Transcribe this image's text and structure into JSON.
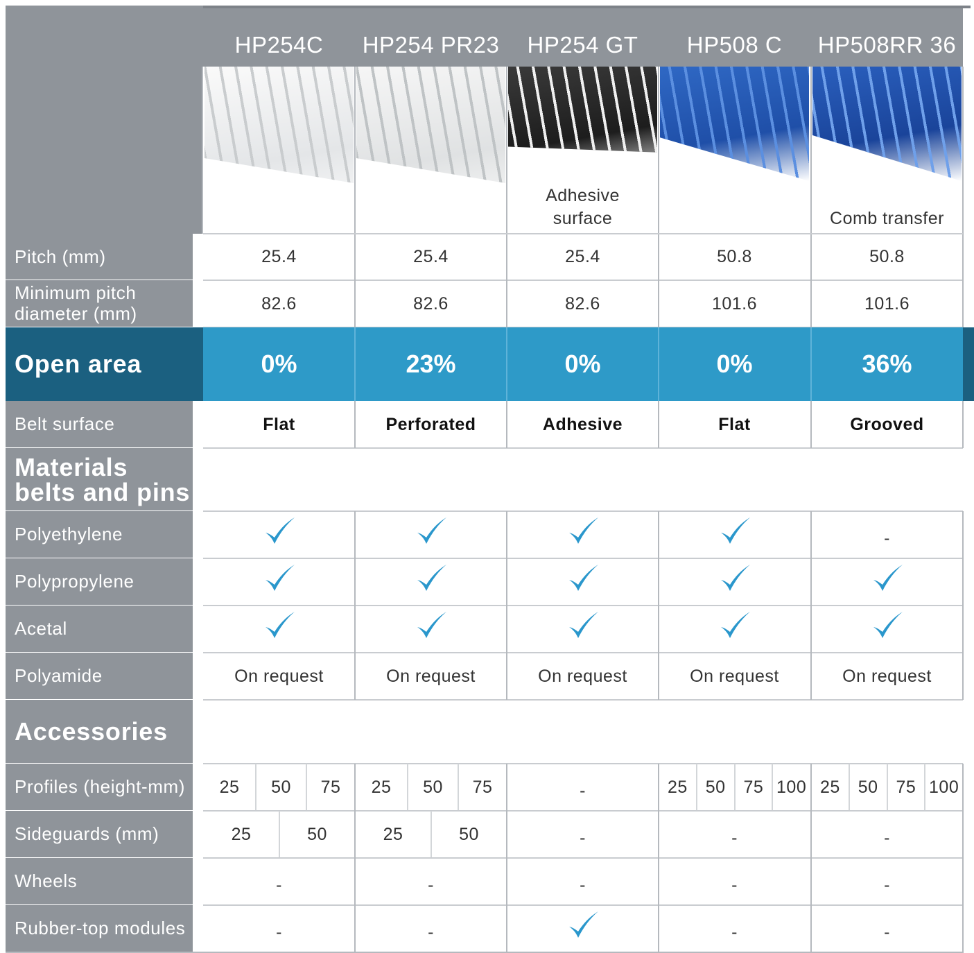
{
  "columns": [
    "HP254C",
    "HP254 PR23",
    "HP254 GT",
    "HP508 C",
    "HP508RR 36"
  ],
  "image_captions": [
    "",
    "",
    "Adhesive\nsurface",
    "",
    "Comb transfer"
  ],
  "rows": {
    "pitch": {
      "label": "Pitch (mm)",
      "values": [
        "25.4",
        "25.4",
        "25.4",
        "50.8",
        "50.8"
      ]
    },
    "min_pitch": {
      "label": "Minimum pitch\ndiameter (mm)",
      "values": [
        "82.6",
        "82.6",
        "82.6",
        "101.6",
        "101.6"
      ]
    },
    "open_area": {
      "label": "Open area",
      "values": [
        "0%",
        "23%",
        "0%",
        "0%",
        "36%"
      ]
    },
    "belt_surface": {
      "label": "Belt surface",
      "values": [
        "Flat",
        "Perforated",
        "Adhesive",
        "Flat",
        "Grooved"
      ]
    },
    "materials_heading": "Materials\nbelts and pins",
    "polyethylene": {
      "label": "Polyethylene",
      "values": [
        "check",
        "check",
        "check",
        "check",
        "-"
      ]
    },
    "polypropylene": {
      "label": "Polypropylene",
      "values": [
        "check",
        "check",
        "check",
        "check",
        "check"
      ]
    },
    "acetal": {
      "label": "Acetal",
      "values": [
        "check",
        "check",
        "check",
        "check",
        "check"
      ]
    },
    "polyamide": {
      "label": "Polyamide",
      "values": [
        "On request",
        "On request",
        "On request",
        "On request",
        "On request"
      ]
    },
    "accessories_heading": "Accessories",
    "profiles": {
      "label": "Profiles (height-mm)",
      "values": [
        [
          "25",
          "50",
          "75"
        ],
        [
          "25",
          "50",
          "75"
        ],
        [
          "-"
        ],
        [
          "25",
          "50",
          "75",
          "100"
        ],
        [
          "25",
          "50",
          "75",
          "100"
        ]
      ]
    },
    "sideguards": {
      "label": "Sideguards (mm)",
      "values": [
        [
          "25",
          "50"
        ],
        [
          "25",
          "50"
        ],
        [
          "-"
        ],
        [
          "-"
        ],
        [
          "-"
        ]
      ]
    },
    "wheels": {
      "label": "Wheels",
      "values": [
        "-",
        "-",
        "-",
        "-",
        "-"
      ]
    },
    "rubber_top": {
      "label": "Rubber-top modules",
      "values": [
        "-",
        "-",
        "check",
        "-",
        "-"
      ]
    }
  },
  "colors": {
    "label_gray": "#8f949a",
    "open_area_blue": "#2e9ac8",
    "open_area_dark": "#1b6080",
    "check_blue": "#2a97cc"
  },
  "icons": {
    "check": "checkmark-icon"
  }
}
